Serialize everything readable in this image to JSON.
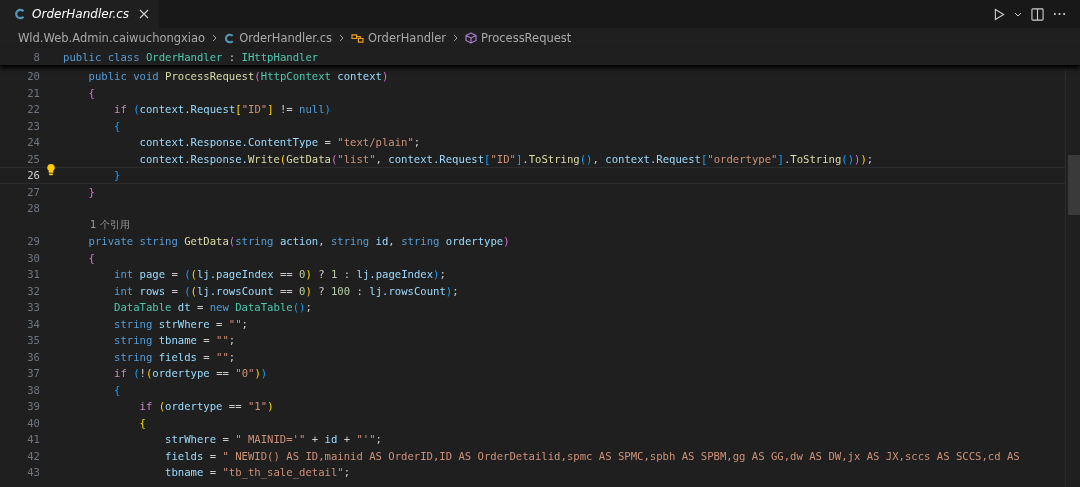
{
  "tab": {
    "label": "OrderHandler.cs",
    "selected": true,
    "preview": true
  },
  "breadcrumbs": [
    {
      "label": "Wld.Web.Admin.caiwuchongxiao",
      "kind": "folder"
    },
    {
      "label": "OrderHandler.cs",
      "kind": "file"
    },
    {
      "label": "OrderHandler",
      "kind": "class"
    },
    {
      "label": "ProcessRequest",
      "kind": "method"
    }
  ],
  "sticky_line": {
    "number": "8",
    "tokens": [
      {
        "text": "public class ",
        "kind": "kw"
      },
      {
        "text": "OrderHandler",
        "kind": "type"
      },
      {
        "text": " : ",
        "kind": "p"
      },
      {
        "text": "IHttpHandler",
        "kind": "type"
      }
    ]
  },
  "lines": [
    {
      "kind": "code",
      "number": "20",
      "current": false,
      "tokens": [
        {
          "text": "    public void ",
          "kind": "kw"
        },
        {
          "text": "ProcessRequest",
          "kind": "fn"
        },
        {
          "text": "(",
          "kind": "b2"
        },
        {
          "text": "HttpContext ",
          "kind": "type"
        },
        {
          "text": "context",
          "kind": "var"
        },
        {
          "text": ")",
          "kind": "b2"
        }
      ]
    },
    {
      "kind": "code",
      "number": "21",
      "current": false,
      "tokens": [
        {
          "text": "    {",
          "kind": "b2"
        }
      ]
    },
    {
      "kind": "code",
      "number": "22",
      "current": false,
      "tokens": [
        {
          "text": "        if ",
          "kind": "ctrl"
        },
        {
          "text": "(",
          "kind": "b3"
        },
        {
          "text": "context",
          "kind": "var"
        },
        {
          "text": ".",
          "kind": "p"
        },
        {
          "text": "Request",
          "kind": "var"
        },
        {
          "text": "[",
          "kind": "b1"
        },
        {
          "text": "\"ID\"",
          "kind": "str"
        },
        {
          "text": "]",
          "kind": "b1"
        },
        {
          "text": " != ",
          "kind": "p"
        },
        {
          "text": "null",
          "kind": "kw"
        },
        {
          "text": ")",
          "kind": "b3"
        }
      ]
    },
    {
      "kind": "code",
      "number": "23",
      "current": false,
      "tokens": [
        {
          "text": "        {",
          "kind": "b3"
        }
      ]
    },
    {
      "kind": "code",
      "number": "24",
      "current": false,
      "tokens": [
        {
          "text": "            context.Response.ContentType",
          "kind": "var"
        },
        {
          "text": " = ",
          "kind": "p"
        },
        {
          "text": "\"text/plain\"",
          "kind": "str"
        },
        {
          "text": ";",
          "kind": "p"
        }
      ]
    },
    {
      "kind": "code",
      "number": "25",
      "current": false,
      "tokens": [
        {
          "text": "            context.Response.",
          "kind": "var"
        },
        {
          "text": "Write",
          "kind": "fn"
        },
        {
          "text": "(",
          "kind": "b1"
        },
        {
          "text": "GetData",
          "kind": "fn"
        },
        {
          "text": "(",
          "kind": "b2"
        },
        {
          "text": "\"list\"",
          "kind": "str"
        },
        {
          "text": ", ",
          "kind": "p"
        },
        {
          "text": "context.Request",
          "kind": "var"
        },
        {
          "text": "[",
          "kind": "b3"
        },
        {
          "text": "\"ID\"",
          "kind": "str"
        },
        {
          "text": "]",
          "kind": "b3"
        },
        {
          "text": ".",
          "kind": "p"
        },
        {
          "text": "ToString",
          "kind": "fn"
        },
        {
          "text": "()",
          "kind": "b3"
        },
        {
          "text": ", ",
          "kind": "p"
        },
        {
          "text": "context.Request",
          "kind": "var"
        },
        {
          "text": "[",
          "kind": "b3"
        },
        {
          "text": "\"ordertype\"",
          "kind": "str"
        },
        {
          "text": "]",
          "kind": "b3"
        },
        {
          "text": ".",
          "kind": "p"
        },
        {
          "text": "ToString",
          "kind": "fn"
        },
        {
          "text": "()",
          "kind": "b3"
        },
        {
          "text": ")",
          "kind": "b2"
        },
        {
          "text": ")",
          "kind": "b1"
        },
        {
          "text": ";",
          "kind": "p"
        }
      ]
    },
    {
      "kind": "code",
      "number": "26",
      "current": true,
      "lightbulb": true,
      "tokens": [
        {
          "text": "        }",
          "kind": "b3"
        }
      ]
    },
    {
      "kind": "code",
      "number": "27",
      "current": false,
      "tokens": [
        {
          "text": "    }",
          "kind": "b2"
        }
      ]
    },
    {
      "kind": "code",
      "number": "28",
      "current": false
    },
    {
      "kind": "codelens",
      "text": "1 个引用"
    },
    {
      "kind": "code",
      "number": "29",
      "current": false,
      "tokens": [
        {
          "text": "    private string ",
          "kind": "kw"
        },
        {
          "text": "GetData",
          "kind": "fn"
        },
        {
          "text": "(",
          "kind": "b2"
        },
        {
          "text": "string ",
          "kind": "kw"
        },
        {
          "text": "action",
          "kind": "var"
        },
        {
          "text": ", ",
          "kind": "p"
        },
        {
          "text": "string ",
          "kind": "kw"
        },
        {
          "text": "id",
          "kind": "var"
        },
        {
          "text": ", ",
          "kind": "p"
        },
        {
          "text": "string ",
          "kind": "kw"
        },
        {
          "text": "ordertype",
          "kind": "var"
        },
        {
          "text": ")",
          "kind": "b2"
        }
      ]
    },
    {
      "kind": "code",
      "number": "30",
      "current": false,
      "tokens": [
        {
          "text": "    {",
          "kind": "b2"
        }
      ]
    },
    {
      "kind": "code",
      "number": "31",
      "current": false,
      "tokens": [
        {
          "text": "        int ",
          "kind": "kw"
        },
        {
          "text": "page",
          "kind": "var"
        },
        {
          "text": " = ",
          "kind": "p"
        },
        {
          "text": "(",
          "kind": "b3"
        },
        {
          "text": "(",
          "kind": "b1"
        },
        {
          "text": "lj.pageIndex",
          "kind": "var"
        },
        {
          "text": " == ",
          "kind": "p"
        },
        {
          "text": "0",
          "kind": "num"
        },
        {
          "text": ")",
          "kind": "b1"
        },
        {
          "text": " ? ",
          "kind": "p"
        },
        {
          "text": "1",
          "kind": "num"
        },
        {
          "text": " : ",
          "kind": "p"
        },
        {
          "text": "lj.pageIndex",
          "kind": "var"
        },
        {
          "text": ")",
          "kind": "b3"
        },
        {
          "text": ";",
          "kind": "p"
        }
      ]
    },
    {
      "kind": "code",
      "number": "32",
      "current": false,
      "tokens": [
        {
          "text": "        int ",
          "kind": "kw"
        },
        {
          "text": "rows",
          "kind": "var"
        },
        {
          "text": " = ",
          "kind": "p"
        },
        {
          "text": "(",
          "kind": "b3"
        },
        {
          "text": "(",
          "kind": "b1"
        },
        {
          "text": "lj.rowsCount",
          "kind": "var"
        },
        {
          "text": " == ",
          "kind": "p"
        },
        {
          "text": "0",
          "kind": "num"
        },
        {
          "text": ")",
          "kind": "b1"
        },
        {
          "text": " ? ",
          "kind": "p"
        },
        {
          "text": "100",
          "kind": "num"
        },
        {
          "text": " : ",
          "kind": "p"
        },
        {
          "text": "lj.rowsCount",
          "kind": "var"
        },
        {
          "text": ")",
          "kind": "b3"
        },
        {
          "text": ";",
          "kind": "p"
        }
      ]
    },
    {
      "kind": "code",
      "number": "33",
      "current": false,
      "tokens": [
        {
          "text": "        DataTable ",
          "kind": "type"
        },
        {
          "text": "dt",
          "kind": "var"
        },
        {
          "text": " = ",
          "kind": "p"
        },
        {
          "text": "new ",
          "kind": "kw"
        },
        {
          "text": "DataTable",
          "kind": "type"
        },
        {
          "text": "()",
          "kind": "b3"
        },
        {
          "text": ";",
          "kind": "p"
        }
      ]
    },
    {
      "kind": "code",
      "number": "34",
      "current": false,
      "tokens": [
        {
          "text": "        string ",
          "kind": "kw"
        },
        {
          "text": "strWhere",
          "kind": "var"
        },
        {
          "text": " = ",
          "kind": "p"
        },
        {
          "text": "\"\"",
          "kind": "str"
        },
        {
          "text": ";",
          "kind": "p"
        }
      ]
    },
    {
      "kind": "code",
      "number": "35",
      "current": false,
      "tokens": [
        {
          "text": "        string ",
          "kind": "kw"
        },
        {
          "text": "tbname",
          "kind": "var"
        },
        {
          "text": " = ",
          "kind": "p"
        },
        {
          "text": "\"\"",
          "kind": "str"
        },
        {
          "text": ";",
          "kind": "p"
        }
      ]
    },
    {
      "kind": "code",
      "number": "36",
      "current": false,
      "tokens": [
        {
          "text": "        string ",
          "kind": "kw"
        },
        {
          "text": "fields",
          "kind": "var"
        },
        {
          "text": " = ",
          "kind": "p"
        },
        {
          "text": "\"\"",
          "kind": "str"
        },
        {
          "text": ";",
          "kind": "p"
        }
      ]
    },
    {
      "kind": "code",
      "number": "37",
      "current": false,
      "tokens": [
        {
          "text": "        if ",
          "kind": "ctrl"
        },
        {
          "text": "(",
          "kind": "b3"
        },
        {
          "text": "!",
          "kind": "p"
        },
        {
          "text": "(",
          "kind": "b1"
        },
        {
          "text": "ordertype",
          "kind": "var"
        },
        {
          "text": " == ",
          "kind": "p"
        },
        {
          "text": "\"0\"",
          "kind": "str"
        },
        {
          "text": ")",
          "kind": "b1"
        },
        {
          "text": ")",
          "kind": "b3"
        }
      ]
    },
    {
      "kind": "code",
      "number": "38",
      "current": false,
      "tokens": [
        {
          "text": "        {",
          "kind": "b3"
        }
      ]
    },
    {
      "kind": "code",
      "number": "39",
      "current": false,
      "tokens": [
        {
          "text": "            if ",
          "kind": "ctrl"
        },
        {
          "text": "(",
          "kind": "b1"
        },
        {
          "text": "ordertype",
          "kind": "var"
        },
        {
          "text": " == ",
          "kind": "p"
        },
        {
          "text": "\"1\"",
          "kind": "str"
        },
        {
          "text": ")",
          "kind": "b1"
        }
      ]
    },
    {
      "kind": "code",
      "number": "40",
      "current": false,
      "tokens": [
        {
          "text": "            {",
          "kind": "b1"
        }
      ]
    },
    {
      "kind": "code",
      "number": "41",
      "current": false,
      "tokens": [
        {
          "text": "                strWhere",
          "kind": "var"
        },
        {
          "text": " = ",
          "kind": "p"
        },
        {
          "text": "\" MAINID='\"",
          "kind": "str"
        },
        {
          "text": " + ",
          "kind": "p"
        },
        {
          "text": "id",
          "kind": "var"
        },
        {
          "text": " + ",
          "kind": "p"
        },
        {
          "text": "\"'\"",
          "kind": "str"
        },
        {
          "text": ";",
          "kind": "p"
        }
      ]
    },
    {
      "kind": "code",
      "number": "42",
      "current": false,
      "tokens": [
        {
          "text": "                fields",
          "kind": "var"
        },
        {
          "text": " = ",
          "kind": "p"
        },
        {
          "text": "\" NEWID() AS ID,mainid AS OrderID,ID AS OrderDetailid,spmc AS SPMC,spbh AS SPBM,gg AS GG,dw AS DW,jx AS JX,sccs AS SCCS,cd AS",
          "kind": "str"
        }
      ]
    },
    {
      "kind": "code",
      "number": "43",
      "current": false,
      "tokens": [
        {
          "text": "                tbname",
          "kind": "var"
        },
        {
          "text": " = ",
          "kind": "p"
        },
        {
          "text": "\"tb_th_sale_detail\"",
          "kind": "str"
        },
        {
          "text": ";",
          "kind": "p"
        }
      ]
    }
  ]
}
